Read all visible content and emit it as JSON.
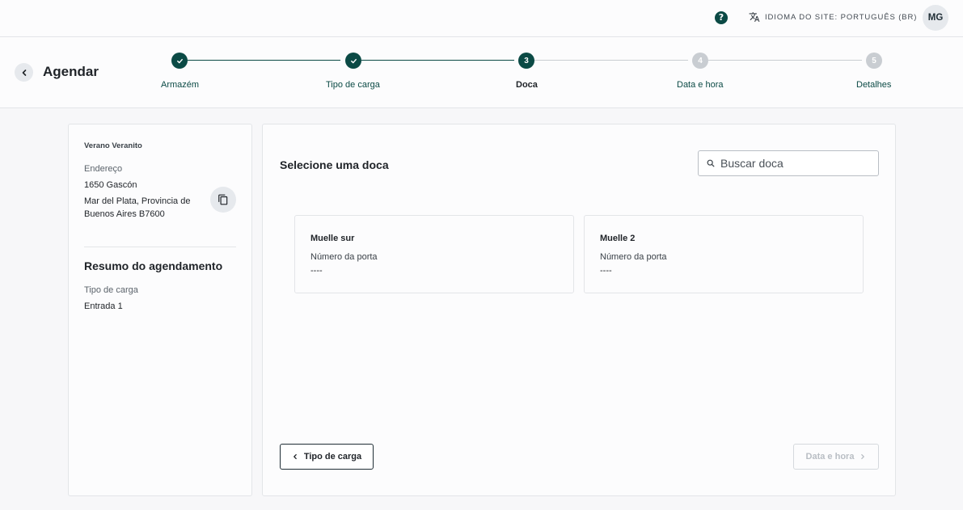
{
  "topbar": {
    "help_icon": "help-circle-icon",
    "help_glyph": "?",
    "language_icon": "translate-icon",
    "language_label": "IDIOMA DO SITE: PORTUGUÊS (BR)",
    "avatar_initials": "MG"
  },
  "header": {
    "back_icon": "chevron-left-icon",
    "title": "Agendar"
  },
  "stepper": {
    "steps": [
      {
        "number": "1",
        "label": "Armazém",
        "state": "done"
      },
      {
        "number": "2",
        "label": "Tipo de carga",
        "state": "done"
      },
      {
        "number": "3",
        "label": "Doca",
        "state": "active"
      },
      {
        "number": "4",
        "label": "Data e hora",
        "state": "todo"
      },
      {
        "number": "5",
        "label": "Detalhes",
        "state": "todo"
      }
    ],
    "done_icon": "check-icon"
  },
  "warehouse": {
    "name": "Verano Veranito",
    "address_label": "Endereço",
    "address_line1": "1650 Gascón",
    "address_line2": "Mar del Plata, Provincia de",
    "address_line3": "Buenos Aires B7600",
    "copy_icon": "copy-icon"
  },
  "summary": {
    "title": "Resumo do agendamento",
    "cargo_label": "Tipo de carga",
    "cargo_value": "Entrada 1"
  },
  "main": {
    "title": "Selecione uma doca",
    "search_placeholder": "Buscar doca",
    "search_value": "",
    "docks": [
      {
        "name": "Muelle sur",
        "door_label": "Número da porta",
        "door_value": "----"
      },
      {
        "name": "Muelle 2",
        "door_label": "Número da porta",
        "door_value": "----"
      }
    ],
    "prev_button": "Tipo de carga",
    "next_button": "Data e hora"
  },
  "colors": {
    "accent": "#0b4a45",
    "inactive": "#c9cdd2",
    "disabled_text": "#b9bec4"
  }
}
